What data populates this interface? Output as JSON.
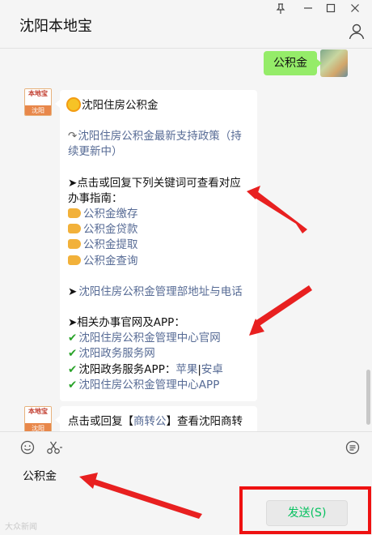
{
  "window": {
    "title": "沈阳本地宝",
    "controls": [
      "pin",
      "minimize",
      "maximize",
      "close"
    ]
  },
  "messages": {
    "outgoing": {
      "text": "公积金"
    },
    "bot_avatar": {
      "top_text": "本地宝",
      "bottom_text": "沈阳"
    },
    "reply1": {
      "heading": "沈阳住房公积金",
      "policy_link": "沈阳住房公积金最新支持政策（持续更新中）",
      "guide_intro": "➤点击或回复下列关键词可查看对应办事指南：",
      "keywords": [
        "公积金缴存",
        "公积金贷款",
        "公积金提取",
        "公积金查询"
      ],
      "address_link": "沈阳住房公积金管理部地址与电话",
      "apps_intro": "➤相关办事官网及APP：",
      "site1": "沈阳住房公积金管理中心官网",
      "site2": "沈阳政务服务网",
      "app_line_prefix": "沈阳政务服务APP：",
      "app_apple": "苹果",
      "app_sep": "|",
      "app_android": "安卓",
      "site3": "沈阳住房公积金管理中心APP"
    },
    "reply2": {
      "prefix": "点击或回复【",
      "keyword": "商转公",
      "suffix": "】查看沈阳商转"
    }
  },
  "input": {
    "tools": [
      "emoji-icon",
      "scissors-icon",
      "chat-history-icon"
    ],
    "value": "公积金",
    "send_label": "发送(S)"
  },
  "watermark": "大众新闻"
}
